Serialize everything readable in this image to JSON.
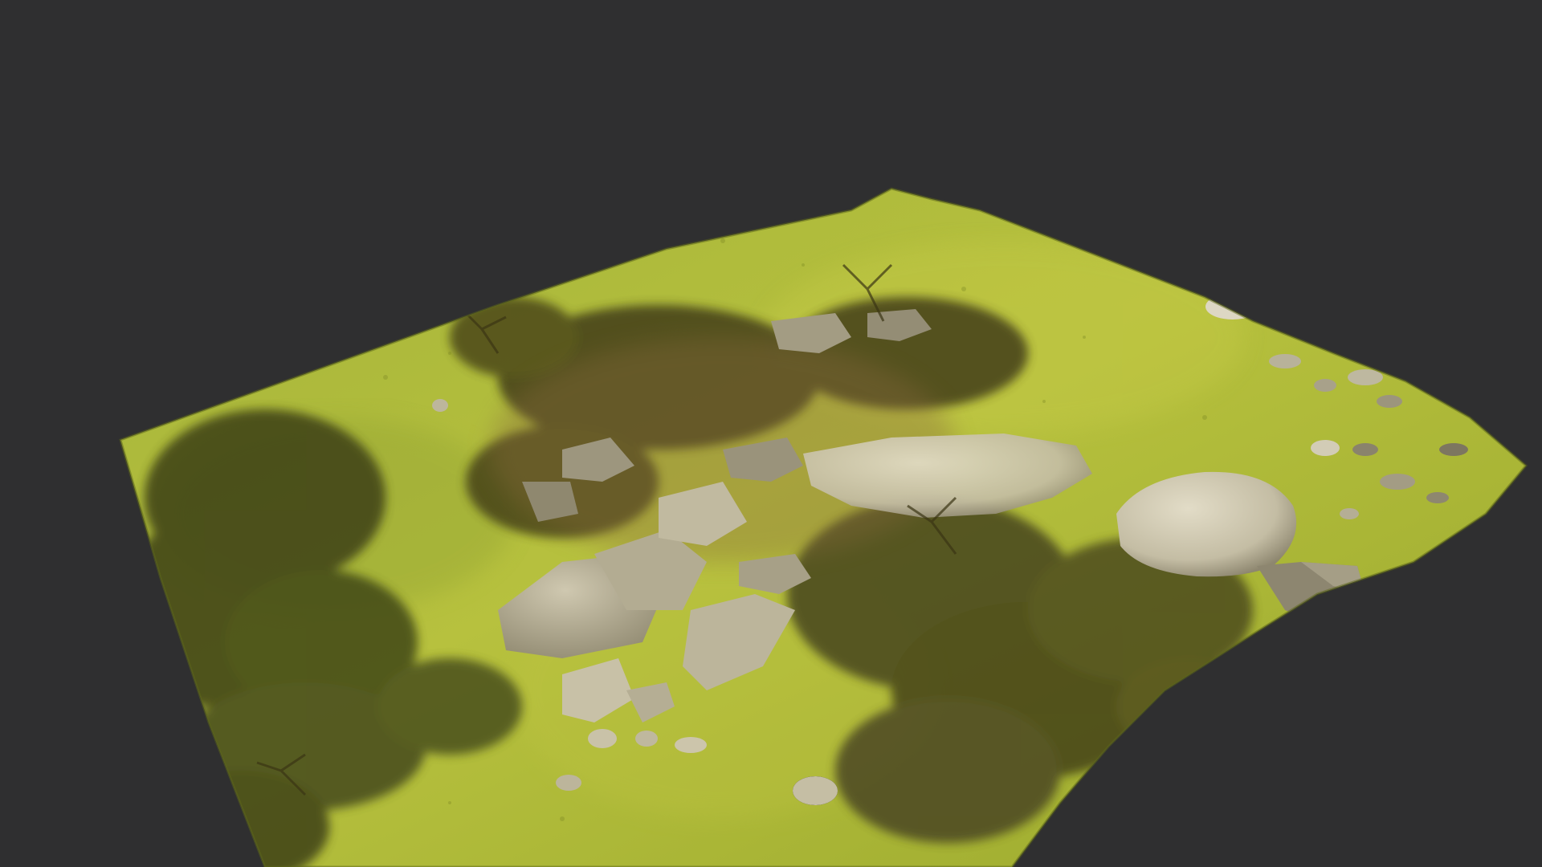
{
  "scene": {
    "kind": "photogrammetry-terrain-mesh",
    "content": [
      "grass",
      "boulder",
      "rock-outcrop",
      "tree-shadow",
      "shrub"
    ],
    "colors": {
      "background": "#2f2f30",
      "grass_light": "#b5c23c",
      "grass_mid": "#93a22c",
      "grass_dark": "#6d7a1c",
      "rock_light": "#d8d2bc",
      "rock_mid": "#a9a28b",
      "rock_dark": "#6d6652",
      "shadow": "#3a3a16",
      "soil": "#8a6a3c"
    }
  }
}
